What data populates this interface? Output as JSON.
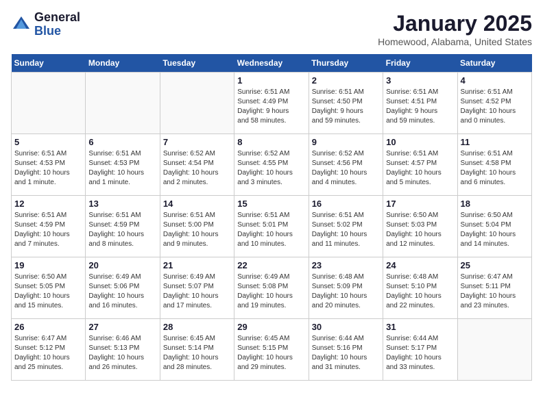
{
  "header": {
    "logo": {
      "general": "General",
      "blue": "Blue"
    },
    "title": "January 2025",
    "location": "Homewood, Alabama, United States"
  },
  "weekdays": [
    "Sunday",
    "Monday",
    "Tuesday",
    "Wednesday",
    "Thursday",
    "Friday",
    "Saturday"
  ],
  "weeks": [
    [
      {
        "day": "",
        "info": ""
      },
      {
        "day": "",
        "info": ""
      },
      {
        "day": "",
        "info": ""
      },
      {
        "day": "1",
        "info": "Sunrise: 6:51 AM\nSunset: 4:49 PM\nDaylight: 9 hours\nand 58 minutes."
      },
      {
        "day": "2",
        "info": "Sunrise: 6:51 AM\nSunset: 4:50 PM\nDaylight: 9 hours\nand 59 minutes."
      },
      {
        "day": "3",
        "info": "Sunrise: 6:51 AM\nSunset: 4:51 PM\nDaylight: 9 hours\nand 59 minutes."
      },
      {
        "day": "4",
        "info": "Sunrise: 6:51 AM\nSunset: 4:52 PM\nDaylight: 10 hours\nand 0 minutes."
      }
    ],
    [
      {
        "day": "5",
        "info": "Sunrise: 6:51 AM\nSunset: 4:53 PM\nDaylight: 10 hours\nand 1 minute."
      },
      {
        "day": "6",
        "info": "Sunrise: 6:51 AM\nSunset: 4:53 PM\nDaylight: 10 hours\nand 1 minute."
      },
      {
        "day": "7",
        "info": "Sunrise: 6:52 AM\nSunset: 4:54 PM\nDaylight: 10 hours\nand 2 minutes."
      },
      {
        "day": "8",
        "info": "Sunrise: 6:52 AM\nSunset: 4:55 PM\nDaylight: 10 hours\nand 3 minutes."
      },
      {
        "day": "9",
        "info": "Sunrise: 6:52 AM\nSunset: 4:56 PM\nDaylight: 10 hours\nand 4 minutes."
      },
      {
        "day": "10",
        "info": "Sunrise: 6:51 AM\nSunset: 4:57 PM\nDaylight: 10 hours\nand 5 minutes."
      },
      {
        "day": "11",
        "info": "Sunrise: 6:51 AM\nSunset: 4:58 PM\nDaylight: 10 hours\nand 6 minutes."
      }
    ],
    [
      {
        "day": "12",
        "info": "Sunrise: 6:51 AM\nSunset: 4:59 PM\nDaylight: 10 hours\nand 7 minutes."
      },
      {
        "day": "13",
        "info": "Sunrise: 6:51 AM\nSunset: 4:59 PM\nDaylight: 10 hours\nand 8 minutes."
      },
      {
        "day": "14",
        "info": "Sunrise: 6:51 AM\nSunset: 5:00 PM\nDaylight: 10 hours\nand 9 minutes."
      },
      {
        "day": "15",
        "info": "Sunrise: 6:51 AM\nSunset: 5:01 PM\nDaylight: 10 hours\nand 10 minutes."
      },
      {
        "day": "16",
        "info": "Sunrise: 6:51 AM\nSunset: 5:02 PM\nDaylight: 10 hours\nand 11 minutes."
      },
      {
        "day": "17",
        "info": "Sunrise: 6:50 AM\nSunset: 5:03 PM\nDaylight: 10 hours\nand 12 minutes."
      },
      {
        "day": "18",
        "info": "Sunrise: 6:50 AM\nSunset: 5:04 PM\nDaylight: 10 hours\nand 14 minutes."
      }
    ],
    [
      {
        "day": "19",
        "info": "Sunrise: 6:50 AM\nSunset: 5:05 PM\nDaylight: 10 hours\nand 15 minutes."
      },
      {
        "day": "20",
        "info": "Sunrise: 6:49 AM\nSunset: 5:06 PM\nDaylight: 10 hours\nand 16 minutes."
      },
      {
        "day": "21",
        "info": "Sunrise: 6:49 AM\nSunset: 5:07 PM\nDaylight: 10 hours\nand 17 minutes."
      },
      {
        "day": "22",
        "info": "Sunrise: 6:49 AM\nSunset: 5:08 PM\nDaylight: 10 hours\nand 19 minutes."
      },
      {
        "day": "23",
        "info": "Sunrise: 6:48 AM\nSunset: 5:09 PM\nDaylight: 10 hours\nand 20 minutes."
      },
      {
        "day": "24",
        "info": "Sunrise: 6:48 AM\nSunset: 5:10 PM\nDaylight: 10 hours\nand 22 minutes."
      },
      {
        "day": "25",
        "info": "Sunrise: 6:47 AM\nSunset: 5:11 PM\nDaylight: 10 hours\nand 23 minutes."
      }
    ],
    [
      {
        "day": "26",
        "info": "Sunrise: 6:47 AM\nSunset: 5:12 PM\nDaylight: 10 hours\nand 25 minutes."
      },
      {
        "day": "27",
        "info": "Sunrise: 6:46 AM\nSunset: 5:13 PM\nDaylight: 10 hours\nand 26 minutes."
      },
      {
        "day": "28",
        "info": "Sunrise: 6:45 AM\nSunset: 5:14 PM\nDaylight: 10 hours\nand 28 minutes."
      },
      {
        "day": "29",
        "info": "Sunrise: 6:45 AM\nSunset: 5:15 PM\nDaylight: 10 hours\nand 29 minutes."
      },
      {
        "day": "30",
        "info": "Sunrise: 6:44 AM\nSunset: 5:16 PM\nDaylight: 10 hours\nand 31 minutes."
      },
      {
        "day": "31",
        "info": "Sunrise: 6:44 AM\nSunset: 5:17 PM\nDaylight: 10 hours\nand 33 minutes."
      },
      {
        "day": "",
        "info": ""
      }
    ]
  ]
}
